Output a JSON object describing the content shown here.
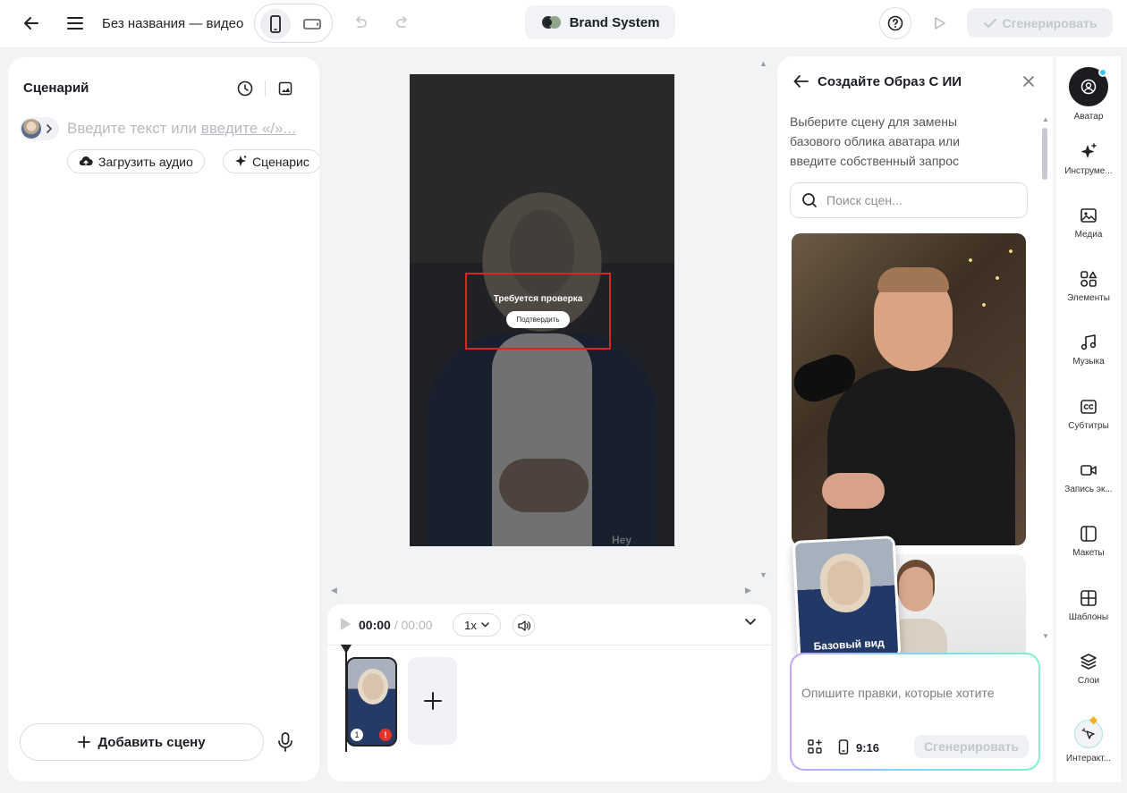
{
  "topbar": {
    "title": "Без названия — видео",
    "brand_label": "Brand System",
    "generate_label": "Сгенерировать"
  },
  "left": {
    "title": "Сценарий",
    "placeholder_main": "Введите текст или ",
    "placeholder_link": "введите «/»...",
    "upload_audio": "Загрузить аудио",
    "script_chip": "Сценарис",
    "add_scene": "Добавить сцену"
  },
  "video": {
    "review_text": "Требуется проверка",
    "confirm_label": "Подтвердить",
    "watermark": "Hey"
  },
  "timeline": {
    "current_time": "00:00",
    "separator": " / ",
    "total_time": "00:00",
    "speed": "1x",
    "clip_number": "1",
    "warn": "!"
  },
  "right_panel": {
    "title": "Создайте Образ С ИИ",
    "description": "Выберите сцену для замены базового облика аватара или введите собственный запрос",
    "search_placeholder": "Поиск сцен...",
    "base_label": "Базовый вид",
    "prompt_placeholder": "Опишите правки, которые хотите",
    "ratio": "9:16",
    "generate_label": "Сгенерировать"
  },
  "rail": {
    "items": [
      {
        "label": "Аватар",
        "icon": "avatar-icon"
      },
      {
        "label": "Инструме...",
        "icon": "sparkle-icon"
      },
      {
        "label": "Медиа",
        "icon": "image-icon"
      },
      {
        "label": "Элементы",
        "icon": "elements-icon"
      },
      {
        "label": "Музыка",
        "icon": "music-icon"
      },
      {
        "label": "Субтитры",
        "icon": "cc-icon"
      },
      {
        "label": "Запись эк...",
        "icon": "record-icon"
      },
      {
        "label": "Макеты",
        "icon": "layout-icon"
      },
      {
        "label": "Шаблоны",
        "icon": "template-icon"
      },
      {
        "label": "Слои",
        "icon": "layers-icon"
      },
      {
        "label": "Интеракт...",
        "icon": "interactive-icon"
      }
    ]
  }
}
